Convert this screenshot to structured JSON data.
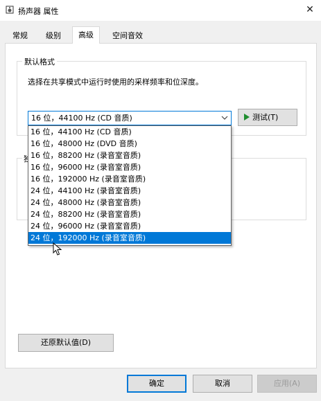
{
  "window": {
    "title": "扬声器 属性",
    "close_glyph": "✕"
  },
  "tabs": [
    {
      "label": "常规"
    },
    {
      "label": "级别"
    },
    {
      "label": "高级"
    },
    {
      "label": "空间音效"
    }
  ],
  "default_format": {
    "legend": "默认格式",
    "description": "选择在共享模式中运行时使用的采样频率和位深度。",
    "selected_value": "16 位，44100 Hz (CD 音质)",
    "test_label": "测试(T)",
    "options": [
      "16 位，44100 Hz (CD 音质)",
      "16 位，48000 Hz (DVD 音质)",
      "16 位，88200 Hz (录音室音质)",
      "16 位，96000 Hz (录音室音质)",
      "16 位，192000 Hz (录音室音质)",
      "24 位，44100 Hz (录音室音质)",
      "24 位，48000 Hz (录音室音质)",
      "24 位，88200 Hz (录音室音质)",
      "24 位，96000 Hz (录音室音质)",
      "24 位，192000 Hz (录音室音质)"
    ],
    "highlighted_option": "24 位，192000 Hz (录音室音质)"
  },
  "exclusive_group": {
    "legend_fragment": "独"
  },
  "restore_label": "还原默认值(D)",
  "footer": {
    "ok_label": "确定",
    "cancel_label": "取消",
    "apply_label": "应用(A)"
  },
  "colors": {
    "accent": "#0078d7",
    "play_green": "#1f8d2e"
  }
}
